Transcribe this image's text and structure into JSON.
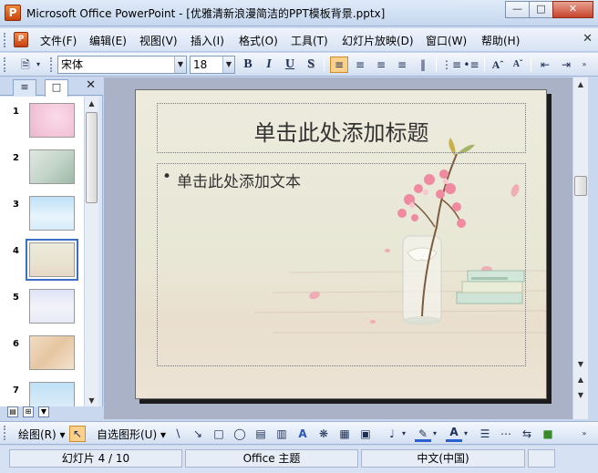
{
  "window": {
    "app_icon_letter": "P",
    "title": "Microsoft Office PowerPoint - [优雅清新浪漫简洁的PPT模板背景.pptx]"
  },
  "menu": {
    "doc_icon_letter": "P",
    "items": [
      {
        "label": "文件(F)"
      },
      {
        "label": "编辑(E)"
      },
      {
        "label": "视图(V)"
      },
      {
        "label": "插入(I)"
      },
      {
        "label": "格式(O)"
      },
      {
        "label": "工具(T)"
      },
      {
        "label": "幻灯片放映(D)"
      },
      {
        "label": "窗口(W)"
      },
      {
        "label": "帮助(H)"
      }
    ]
  },
  "toolbar": {
    "font_name": "宋体",
    "font_size": "18",
    "bold": "B",
    "italic": "I",
    "underline": "U",
    "shadow": "S"
  },
  "left_panel": {
    "thumbnails": [
      {
        "number": "1"
      },
      {
        "number": "2"
      },
      {
        "number": "3"
      },
      {
        "number": "4"
      },
      {
        "number": "5"
      },
      {
        "number": "6"
      },
      {
        "number": "7"
      }
    ],
    "selected_slide": 4
  },
  "slide": {
    "title_placeholder": "单击此处添加标题",
    "bullet": "•",
    "body_placeholder": "单击此处添加文本"
  },
  "drawbar": {
    "draw_label": "绘图(R)",
    "autoshapes_label": "自选图形(U)"
  },
  "status": {
    "slide_info": "幻灯片 4 / 10",
    "theme": "Office 主题",
    "language": "中文(中国)"
  },
  "colors": {
    "accent_selected": "#fbd08a",
    "selection_outline": "#3a6fc4",
    "chrome": "#c9d8ee"
  }
}
